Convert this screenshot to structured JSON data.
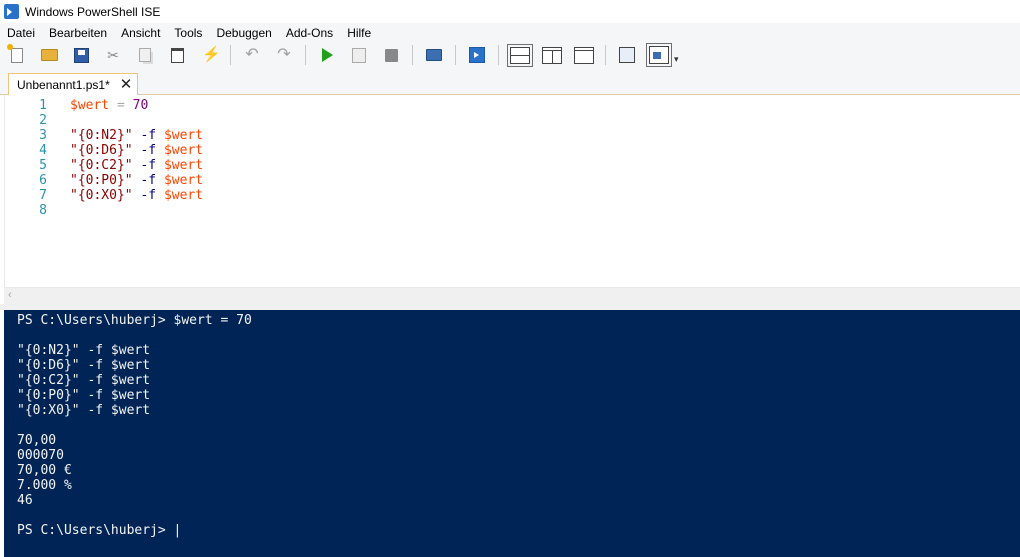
{
  "window": {
    "title": "Windows PowerShell ISE"
  },
  "menu": [
    "Datei",
    "Bearbeiten",
    "Ansicht",
    "Tools",
    "Debuggen",
    "Add-Ons",
    "Hilfe"
  ],
  "toolbar": {
    "icons": [
      "new-script-icon",
      "open-icon",
      "save-icon",
      "cut-icon",
      "copy-icon",
      "paste-icon",
      "clear-console-icon",
      "undo-icon",
      "redo-icon",
      "run-script-icon",
      "run-selection-icon",
      "stop-icon",
      "remote-powershell-icon",
      "powershell-console-icon",
      "layout-top-icon",
      "layout-right-icon",
      "layout-max-icon",
      "show-script-pane-icon",
      "show-command-addon-icon"
    ]
  },
  "tab": {
    "label": "Unbenannt1.ps1*",
    "close": "✕"
  },
  "editor": {
    "lines": [
      {
        "num": "1",
        "var": "$wert",
        "op": " = ",
        "num_val": "70"
      },
      {
        "num": "2"
      },
      {
        "num": "3",
        "str": "\"{0:N2}\"",
        "param": " -f ",
        "var": "$wert"
      },
      {
        "num": "4",
        "str": "\"{0:D6}\"",
        "param": " -f ",
        "var": "$wert"
      },
      {
        "num": "5",
        "str": "\"{0:C2}\"",
        "param": " -f ",
        "var": "$wert"
      },
      {
        "num": "6",
        "str": "\"{0:P0}\"",
        "param": " -f ",
        "var": "$wert"
      },
      {
        "num": "7",
        "str": "\"{0:X0}\"",
        "param": " -f ",
        "var": "$wert"
      },
      {
        "num": "8"
      }
    ]
  },
  "console": {
    "lines": [
      "PS C:\\Users\\huberj> $wert = 70",
      "",
      "\"{0:N2}\" -f $wert",
      "\"{0:D6}\" -f $wert",
      "\"{0:C2}\" -f $wert",
      "\"{0:P0}\" -f $wert",
      "\"{0:X0}\" -f $wert",
      "",
      "70,00",
      "000070",
      "70,00 €",
      "7.000 %",
      "46",
      "",
      "PS C:\\Users\\huberj> |"
    ]
  },
  "colors": {
    "console_bg": "#012456",
    "console_fg": "#f5f5f5",
    "line_number": "#2b91af",
    "string": "#8b0000",
    "variable": "#ff4500",
    "tab_border": "#f0c27a"
  }
}
